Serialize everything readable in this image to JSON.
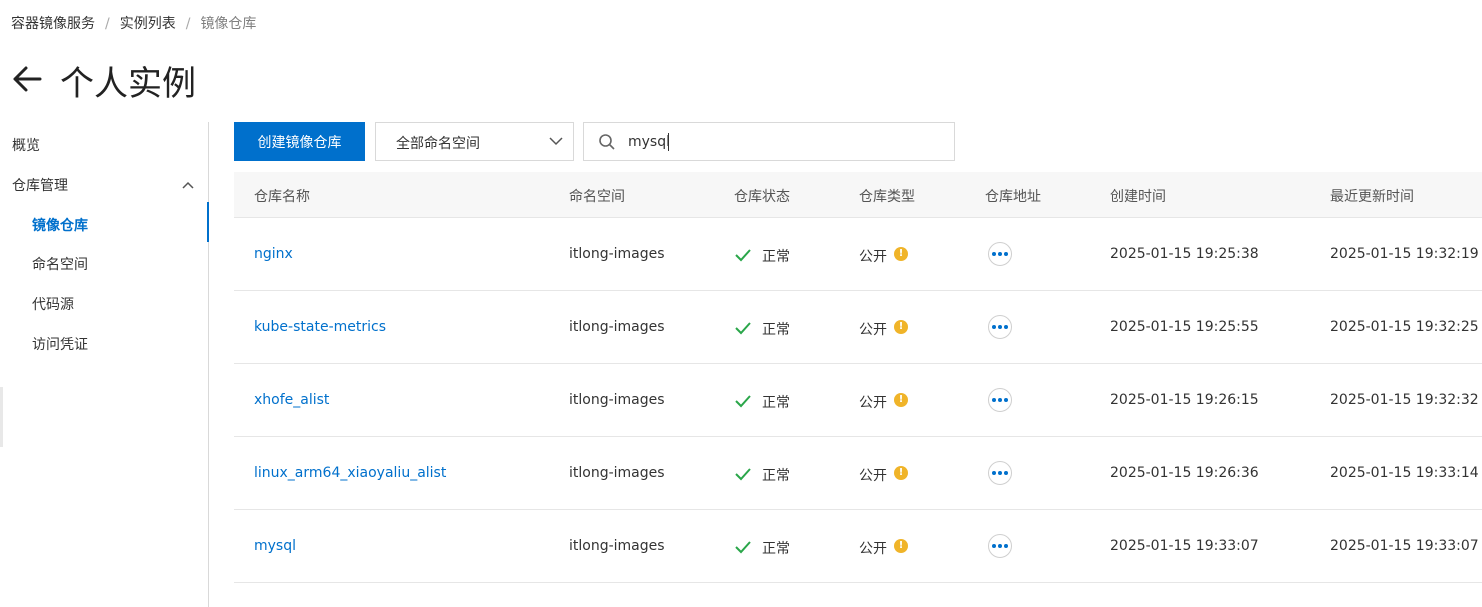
{
  "breadcrumb": [
    "容器镜像服务",
    "实例列表",
    "镜像仓库"
  ],
  "breadcrumb_separator": "/",
  "page": {
    "title": "个人实例"
  },
  "sidebar": {
    "overview": "概览",
    "group_label": "仓库管理",
    "items": [
      "镜像仓库",
      "命名空间",
      "代码源",
      "访问凭证"
    ]
  },
  "toolbar": {
    "create_label": "创建镜像仓库",
    "namespace_select_value": "全部命名空间",
    "search_value": "mysql"
  },
  "table": {
    "headers": [
      "仓库名称",
      "命名空间",
      "仓库状态",
      "仓库类型",
      "仓库地址",
      "创建时间",
      "最近更新时间"
    ],
    "rows": [
      {
        "name": "nginx",
        "namespace": "itlong-images",
        "status": "正常",
        "type": "公开",
        "created": "2025-01-15 19:25:38",
        "updated": "2025-01-15 19:32:19"
      },
      {
        "name": "kube-state-metrics",
        "namespace": "itlong-images",
        "status": "正常",
        "type": "公开",
        "created": "2025-01-15 19:25:55",
        "updated": "2025-01-15 19:32:25"
      },
      {
        "name": "xhofe_alist",
        "namespace": "itlong-images",
        "status": "正常",
        "type": "公开",
        "created": "2025-01-15 19:26:15",
        "updated": "2025-01-15 19:32:32"
      },
      {
        "name": "linux_arm64_xiaoyaliu_alist",
        "namespace": "itlong-images",
        "status": "正常",
        "type": "公开",
        "created": "2025-01-15 19:26:36",
        "updated": "2025-01-15 19:33:14"
      },
      {
        "name": "mysql",
        "namespace": "itlong-images",
        "status": "正常",
        "type": "公开",
        "created": "2025-01-15 19:33:07",
        "updated": "2025-01-15 19:33:07"
      }
    ]
  },
  "icons": {
    "back": "arrow-left-icon",
    "chevron": "chevron-down-icon",
    "collapse": "chevron-up-icon",
    "search": "search-icon",
    "status": "check-icon",
    "warn": "warning-icon",
    "more": "more-icon"
  },
  "colors": {
    "primary": "#0070cc",
    "success": "#2aa64a",
    "warning": "#f0b429"
  }
}
